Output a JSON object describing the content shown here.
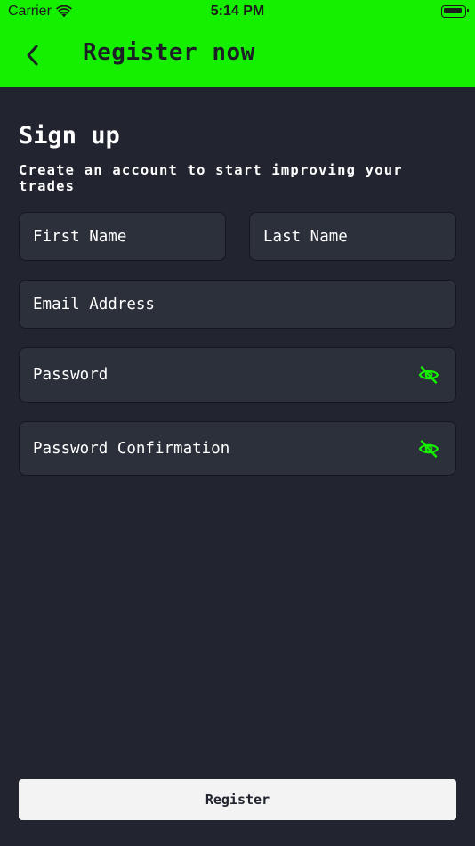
{
  "status_bar": {
    "carrier": "Carrier",
    "time": "5:14 PM",
    "icons": [
      "wifi-icon",
      "battery-icon"
    ]
  },
  "nav": {
    "back_icon": "chevron-left-icon",
    "title": "Register now"
  },
  "form": {
    "heading": "Sign up",
    "subheading": "Create an account to start improving your trades",
    "first_name_placeholder": "First Name",
    "last_name_placeholder": "Last Name",
    "email_placeholder": "Email Address",
    "password_placeholder": "Password",
    "password_confirmation_placeholder": "Password Confirmation",
    "password_visibility_icon": "eye-off-icon",
    "submit_label": "Register"
  },
  "colors": {
    "accent": "#15f000",
    "background": "#22252f",
    "field_background": "#2c303b",
    "button_background": "#f3f3f3"
  }
}
